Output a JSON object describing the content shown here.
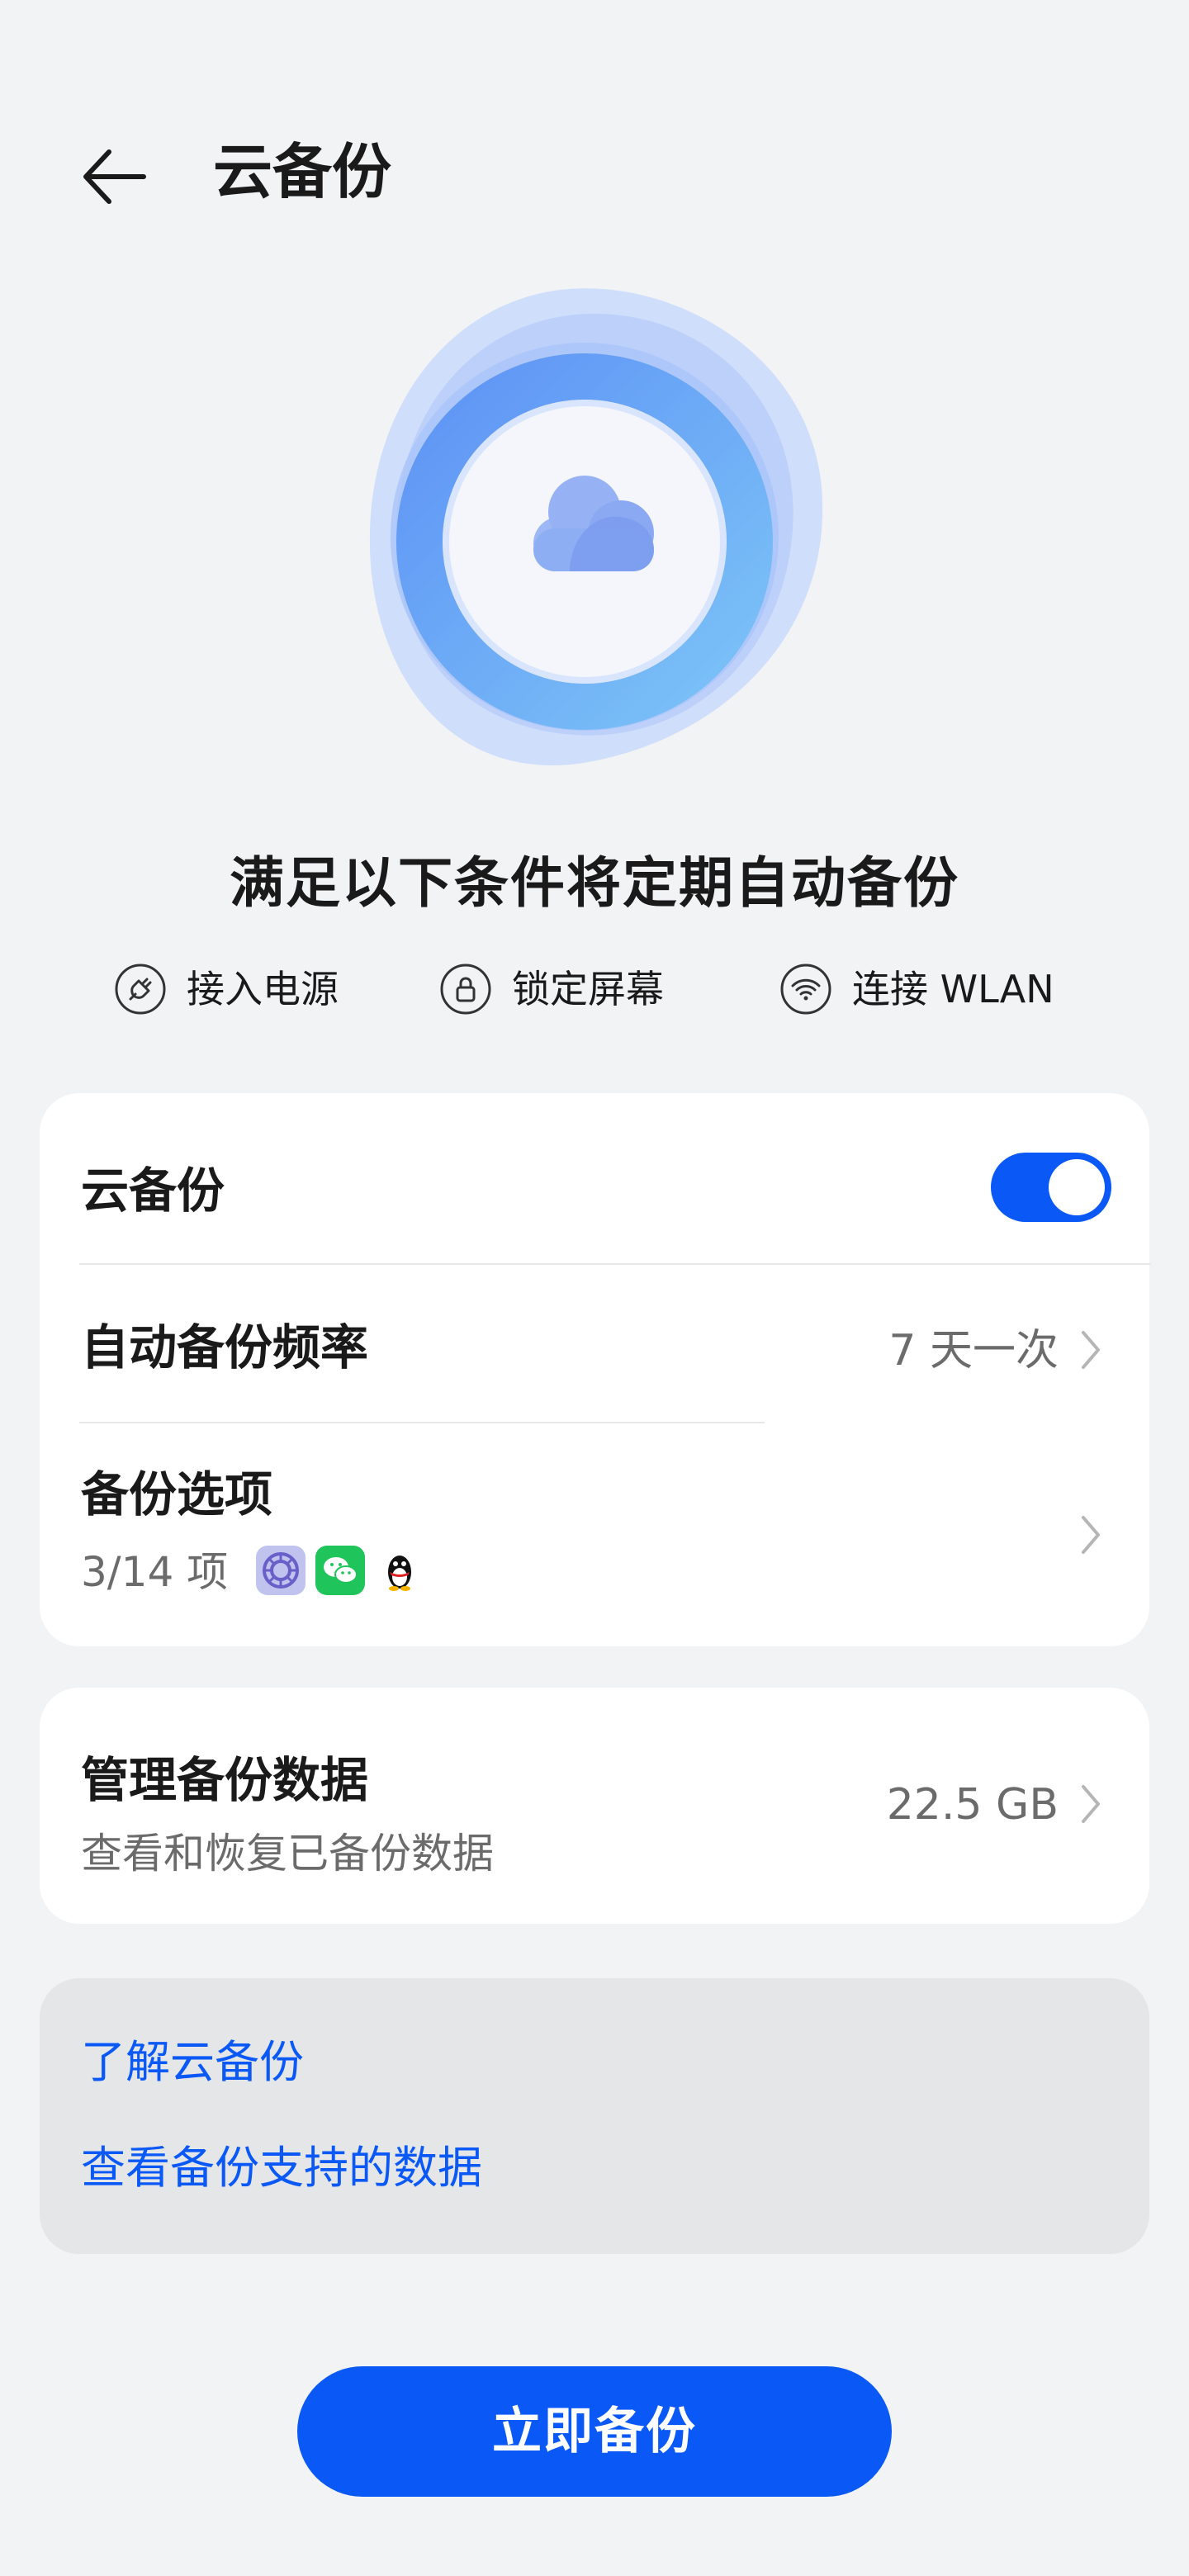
{
  "header": {
    "title": "云备份"
  },
  "conditions": {
    "title": "满足以下条件将定期自动备份",
    "items": [
      {
        "icon": "power-plug-icon",
        "label": "接入电源"
      },
      {
        "icon": "lock-icon",
        "label": "锁定屏幕"
      },
      {
        "icon": "wifi-icon",
        "label": "连接 WLAN"
      }
    ]
  },
  "settings": {
    "cloud_backup": {
      "label": "云备份",
      "enabled": true
    },
    "frequency": {
      "label": "自动备份频率",
      "value": "7 天一次"
    },
    "options": {
      "label": "备份选项",
      "summary": "3/14 项",
      "app_icons": [
        "settings-app-icon",
        "wechat-app-icon",
        "qq-app-icon"
      ]
    }
  },
  "manage": {
    "label": "管理备份数据",
    "subtitle": "查看和恢复已备份数据",
    "size": "22.5 GB"
  },
  "links": {
    "learn": "了解云备份",
    "supported": "查看备份支持的数据"
  },
  "actions": {
    "backup_now": "立即备份"
  },
  "colors": {
    "accent": "#0a59f7",
    "background": "#f1f3f5",
    "card": "#ffffff"
  }
}
